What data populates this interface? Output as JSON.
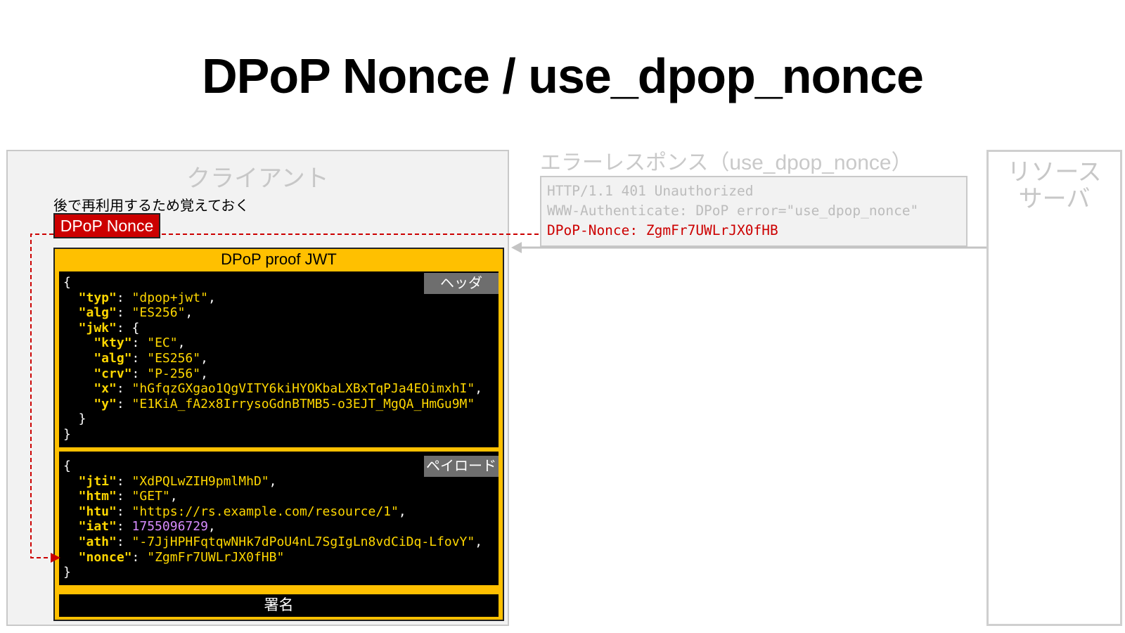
{
  "title": "DPoP Nonce / use_dpop_nonce",
  "client": {
    "label": "クライアント",
    "note": "後で再利用するため覚えておく",
    "nonce_badge": "DPoP Nonce"
  },
  "resource_server": {
    "label_line1": "リソース",
    "label_line2": "サーバ"
  },
  "error_response": {
    "title": "エラーレスポンス（use_dpop_nonce）",
    "lines": [
      "HTTP/1.1 401 Unauthorized",
      "WWW-Authenticate: DPoP error=\"use_dpop_nonce\"",
      "DPoP-Nonce: ZgmFr7UWLrJX0fHB"
    ]
  },
  "jwt": {
    "title": "DPoP proof JWT",
    "header_tag": "ヘッダ",
    "payload_tag": "ペイロード",
    "signature_label": "署名",
    "header": {
      "typ": "dpop+jwt",
      "alg": "ES256",
      "jwk": {
        "kty": "EC",
        "alg": "ES256",
        "crv": "P-256",
        "x": "hGfqzGXgao1QgVITY6kiHYOKbaLXBxTqPJa4EOimxhI",
        "y": "E1KiA_fA2x8IrrysoGdnBTMB5-o3EJT_MgQA_HmGu9M"
      }
    },
    "payload": {
      "jti": "XdPQLwZIH9pmlMhD",
      "htm": "GET",
      "htu": "https://rs.example.com/resource/1",
      "iat": "1755096729",
      "ath": "-7JjHPHFqtqwNHk7dPoU4nL7SgIgLn8vdCiDq-LfovY",
      "nonce": "ZgmFr7UWLrJX0fHB"
    }
  },
  "colors": {
    "nonce_red": "#cc0000",
    "jwt_yellow": "#ffc000",
    "code_key": "#ffd700",
    "code_number": "#d88cff",
    "muted_gray": "#c7c7c7"
  }
}
